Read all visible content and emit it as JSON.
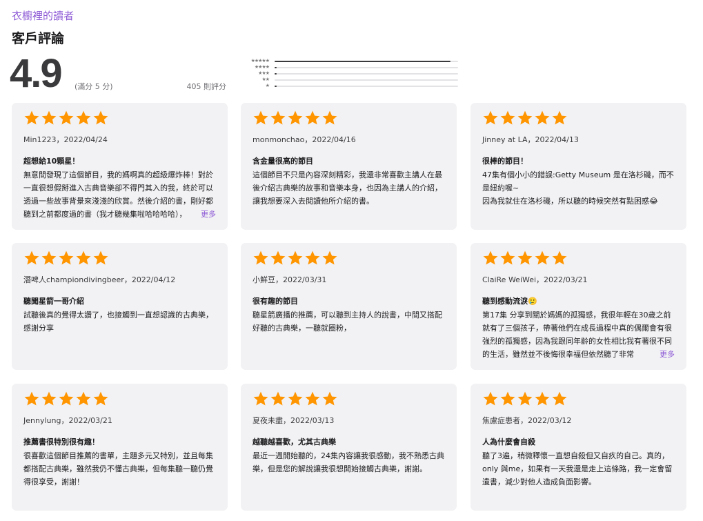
{
  "header": {
    "podcast_link": "衣櫥裡的讀者",
    "section_title": "客戶評論",
    "average": "4.9",
    "out_of": "(滿分 5 分)",
    "count": "405 則評分"
  },
  "histogram": [
    {
      "stars": 5,
      "fraction": 0.96
    },
    {
      "stars": 4,
      "fraction": 0.01
    },
    {
      "stars": 3,
      "fraction": 0.01
    },
    {
      "stars": 2,
      "fraction": 0.0
    },
    {
      "stars": 1,
      "fraction": 0.01
    }
  ],
  "colors": {
    "star": "#ff9500",
    "accent": "#8e5bd6",
    "card_bg": "#f2f2f4"
  },
  "more_label": "更多",
  "reviews": [
    {
      "rating": 5,
      "reviewer": "Min1223，2022/04/24",
      "title": "超想給10顆星！",
      "body": "無意間發現了這個節目，我的媽啊真的超級爆炸棒！對於一直很想假掰進入古典音樂卻不得門其入的我，終於可以透過一些故事背景來淺淺的欣賞。然後介紹的書，剛好都聽到之前都度過的書（我才聽幾集啦哈哈哈哈），",
      "has_more": true
    },
    {
      "rating": 5,
      "reviewer": "monmonchao，2022/04/16",
      "title": "含金量很高的節目",
      "body": "這個節目不只是內容深刻精彩，我還非常喜歡主講人在最後介紹古典樂的故事和音樂本身，也因為主講人的介紹，讓我想要深入去閱讀他所介紹的書。",
      "has_more": false
    },
    {
      "rating": 5,
      "reviewer": "Jinney at LA，2022/04/13",
      "title": "很棒的節目！",
      "body": "47集有個小小的錯誤:Getty Museum 是在洛杉磯，而不是紐約喔~\n因為我就住在洛杉磯，所以聽的時候突然有點困惑😂",
      "has_more": false
    },
    {
      "rating": 5,
      "reviewer": "潛啤人championdivingbeer，2022/04/12",
      "title": "聽聞星箭一哥介紹",
      "body": "試聽後真的覺得太讚了，也接觸到一直想認識的古典樂，感謝分享",
      "has_more": false
    },
    {
      "rating": 5,
      "reviewer": "小鮮豆，2022/03/31",
      "title": "很有趣的節目",
      "body": "聽星箭廣播的推薦，可以聽到主持人的說書，中間又搭配好聽的古典樂，一聽就圈粉，",
      "has_more": false
    },
    {
      "rating": 5,
      "reviewer": "ClaiRe WeiWei，2022/03/21",
      "title": "聽到感動流淚🥲",
      "body": "第17集 分享到關於媽媽的孤獨感，我很年輕在30歲之前就有了三個孩子，帶著他們在成長過程中真的偶爾會有很強烈的孤獨感，因為我跟同年齡的女性相比我有著很不同的生活，雖然並不後悔很幸福但依然聽了非常",
      "has_more": true
    },
    {
      "rating": 5,
      "reviewer": "Jennylung，2022/03/21",
      "title": "推薦書很特別很有趣！",
      "body": "很喜歡這個節目推薦的書單，主題多元又特別，並且每集都搭配古典樂，雖然我仍不懂古典樂，但每集聽一聽仍覺得很享受，謝謝！",
      "has_more": false
    },
    {
      "rating": 5,
      "reviewer": "夏夜未盡，2022/03/13",
      "title": "越聽越喜歡，尤其古典樂",
      "body": "最近一週開始聽的，24集內容讓我很感動，我不熟悉古典樂，但是您的解說讓我很想開始接觸古典樂，謝謝。",
      "has_more": false
    },
    {
      "rating": 5,
      "reviewer": "焦慮症患者，2022/03/12",
      "title": "人為什麼會自殺",
      "body": "聽了3遍，稍微釋懷一直想自殺但又自疚的自己。真的，only 與me，如果有一天我還是走上這條路，我一定會留遺書，減少對他人造成負面影響。",
      "has_more": false
    }
  ]
}
